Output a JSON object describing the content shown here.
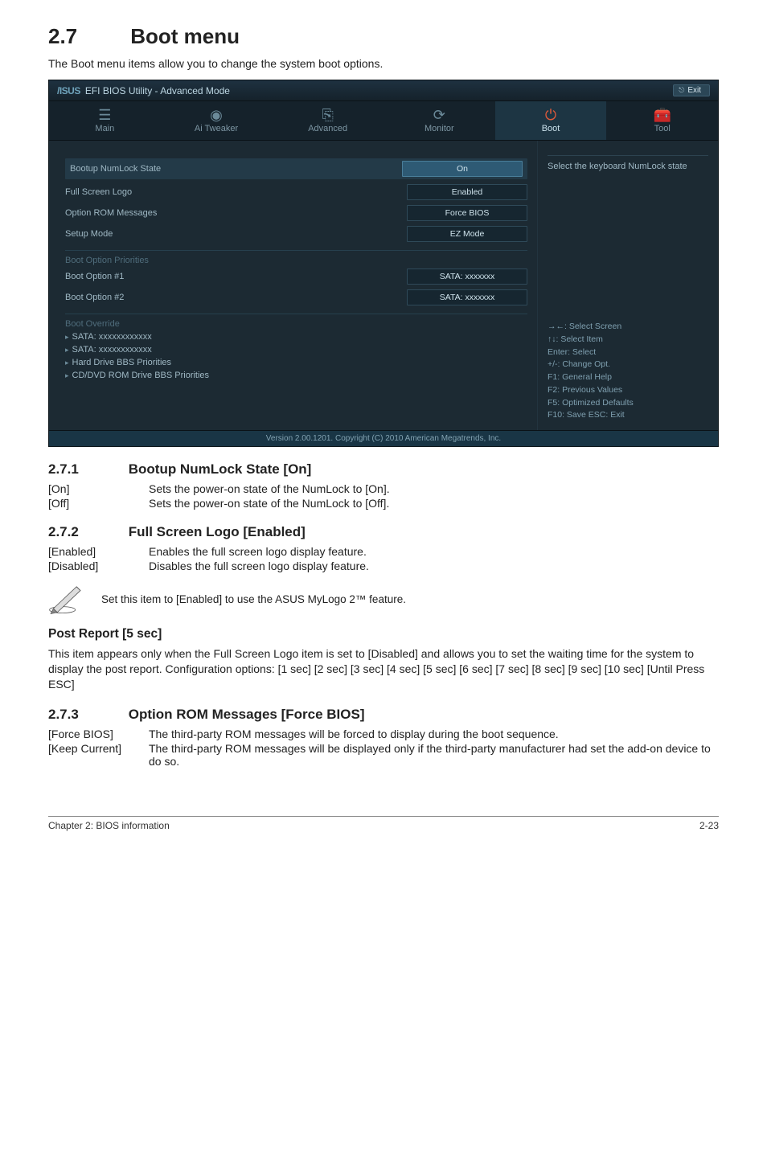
{
  "section": {
    "number": "2.7",
    "title": "Boot menu",
    "intro": "The Boot menu items allow you to change the system boot options."
  },
  "bios": {
    "logo_prefix": "/ISUS",
    "header_title": "EFI BIOS Utility - Advanced Mode",
    "exit": "Exit",
    "tabs": {
      "main": "Main",
      "tweaker": "Ai  Tweaker",
      "advanced": "Advanced",
      "monitor": "Monitor",
      "boot": "Boot",
      "tool": "Tool"
    },
    "rows": {
      "numlock_label": "Bootup NumLock State",
      "numlock_val": "On",
      "fslogo_label": "Full Screen Logo",
      "fslogo_val": "Enabled",
      "optrom_label": "Option ROM Messages",
      "optrom_val": "Force BIOS",
      "setup_label": "Setup Mode",
      "setup_val": "EZ Mode"
    },
    "priorities": {
      "header": "Boot Option Priorities",
      "opt1_label": "Boot Option #1",
      "opt1_val": "SATA: xxxxxxx",
      "opt2_label": "Boot Option #2",
      "opt2_val": "SATA: xxxxxxx"
    },
    "override": {
      "header": "Boot Override",
      "sata1": "SATA: xxxxxxxxxxxx",
      "sata2": "SATA: xxxxxxxxxxxx",
      "hdd": "Hard Drive BBS Priorities",
      "cddvd": "CD/DVD ROM Drive BBS Priorities"
    },
    "help_top": "Select the keyboard NumLock state",
    "help_bottom": {
      "l1": "→←:  Select Screen",
      "l2": "↑↓:  Select Item",
      "l3": "Enter:  Select",
      "l4": "+/-:  Change Opt.",
      "l5": "F1:  General Help",
      "l6": "F2:  Previous Values",
      "l7": "F5:  Optimized Defaults",
      "l8": "F10:  Save   ESC:  Exit"
    },
    "footer": "Version  2.00.1201.   Copyright  (C)  2010  American  Megatrends,  Inc."
  },
  "s271": {
    "num": "2.7.1",
    "title": "Bootup NumLock State [On]",
    "on_key": "[On]",
    "on_val": "Sets the power-on state of the NumLock to [On].",
    "off_key": "[Off]",
    "off_val": "Sets the power-on state of the NumLock to [Off]."
  },
  "s272": {
    "num": "2.7.2",
    "title": "Full Screen Logo [Enabled]",
    "en_key": "[Enabled]",
    "en_val": "Enables the full screen logo display feature.",
    "dis_key": "[Disabled]",
    "dis_val": "Disables the full screen logo display feature.",
    "note": "Set this item to [Enabled] to use the ASUS MyLogo 2™ feature."
  },
  "post_report": {
    "title": "Post Report [5 sec]",
    "body": "This item appears only when the Full Screen Logo item is set to [Disabled] and allows you to set the waiting time for the system to display the post report. Configuration options: [1 sec] [2 sec] [3 sec] [4 sec] [5 sec] [6 sec] [7 sec] [8 sec] [9 sec] [10 sec] [Until Press ESC]"
  },
  "s273": {
    "num": "2.7.3",
    "title": "Option ROM Messages [Force BIOS]",
    "fb_key": "[Force BIOS]",
    "fb_val": "The third-party ROM messages will be forced to display during the boot sequence.",
    "kc_key": "[Keep Current]",
    "kc_val": "The third-party ROM messages will be displayed only if the third-party manufacturer had set the add-on device to do so."
  },
  "chart_data": null,
  "footer": {
    "left": "Chapter 2: BIOS information",
    "right": "2-23"
  }
}
